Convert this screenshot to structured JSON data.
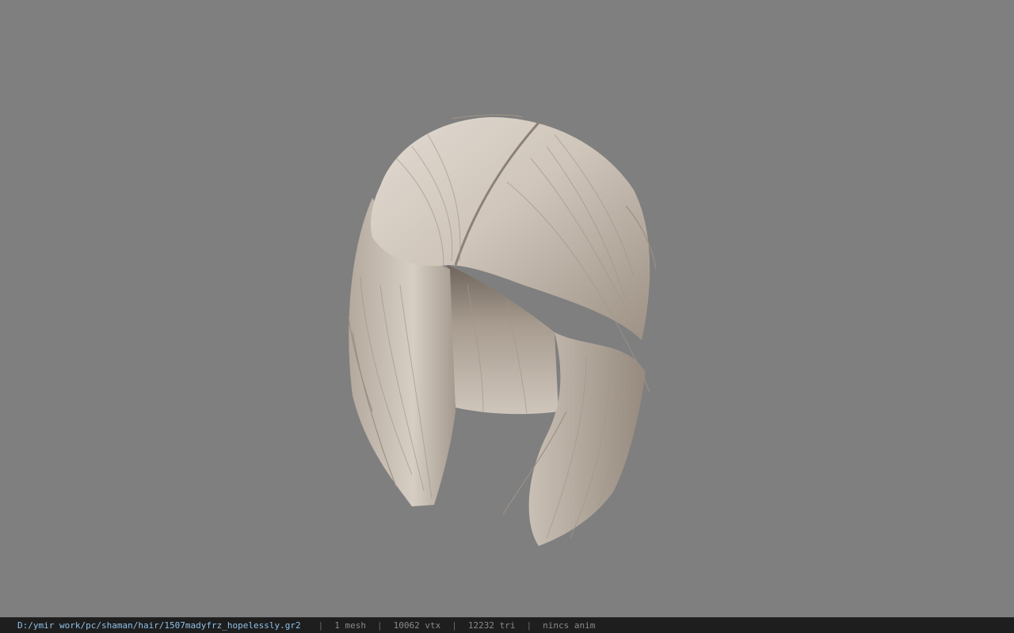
{
  "viewport": {
    "background_color": "#7f7f7f",
    "model": "hair mesh",
    "hair_color_light": "#d8d0c6",
    "hair_color_dark": "#8c8176"
  },
  "status": {
    "file_path": "D:/ymir work/pc/shaman/hair/1507madyfrz_hopelessly.gr2",
    "separator": "|",
    "mesh_count": "1 mesh",
    "vertex_count": "10062 vtx",
    "triangle_count": "12232 tri",
    "anim": "nincs anim"
  }
}
